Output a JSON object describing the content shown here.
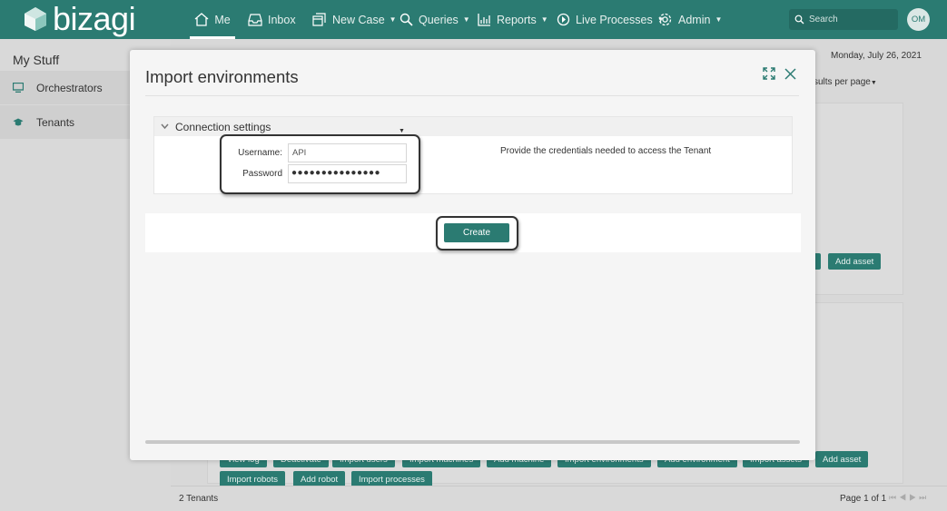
{
  "app": {
    "brand": "bizagi",
    "accent_color": "#2b7b72"
  },
  "nav": {
    "me": "Me",
    "inbox": "Inbox",
    "new_case": "New Case",
    "queries": "Queries",
    "reports": "Reports",
    "live_processes": "Live Processes",
    "admin": "Admin",
    "search_placeholder": "Search",
    "avatar_initials": "OM"
  },
  "sidebar": {
    "title": "My Stuff",
    "items": [
      {
        "label": "Orchestrators",
        "icon": "monitor-icon"
      },
      {
        "label": "Tenants",
        "icon": "graduation-cap-icon"
      }
    ]
  },
  "background": {
    "date": "Monday, July 26, 2021",
    "results_per_page": "sults per page",
    "panel1_buttons": [
      "Add asset"
    ],
    "panel2_buttons_row1": [
      "View log",
      "Deactivate",
      "Import users",
      "Import machines",
      "Add machine",
      "Import environments",
      "Add environment",
      "Import assets",
      "Add asset"
    ],
    "panel2_buttons_row2": [
      "Import robots",
      "Add robot",
      "Import processes"
    ]
  },
  "footer": {
    "count": "2 Tenants",
    "page": "Page 1 of 1"
  },
  "modal": {
    "title": "Import environments",
    "section_title": "Connection settings",
    "username_label": "Username:",
    "username_value": "API",
    "password_label": "Password",
    "password_dots": "●●●●●●●●●●●●●●●",
    "hint": "Provide the credentials needed to access the Tenant",
    "create_label": "Create"
  }
}
